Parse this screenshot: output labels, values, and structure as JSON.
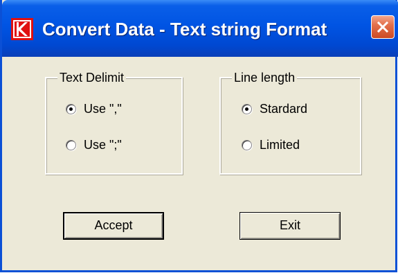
{
  "window": {
    "title": "Convert Data - Text string Format",
    "icon": "app-k-logo-icon",
    "close_icon": "close-icon"
  },
  "text_delimit": {
    "legend": "Text Delimit",
    "options": [
      {
        "label": "Use \",\"",
        "checked": true
      },
      {
        "label": "Use \";\"",
        "checked": false
      }
    ]
  },
  "line_length": {
    "legend": "Line length",
    "options": [
      {
        "label": "Stardard",
        "checked": true
      },
      {
        "label": "Limited",
        "checked": false
      }
    ]
  },
  "buttons": {
    "accept_label": "Accept",
    "exit_label": "Exit"
  },
  "colors": {
    "title_bar": "#0054e3",
    "dialog_bg": "#ece9d8",
    "close_button": "#e3704c"
  }
}
